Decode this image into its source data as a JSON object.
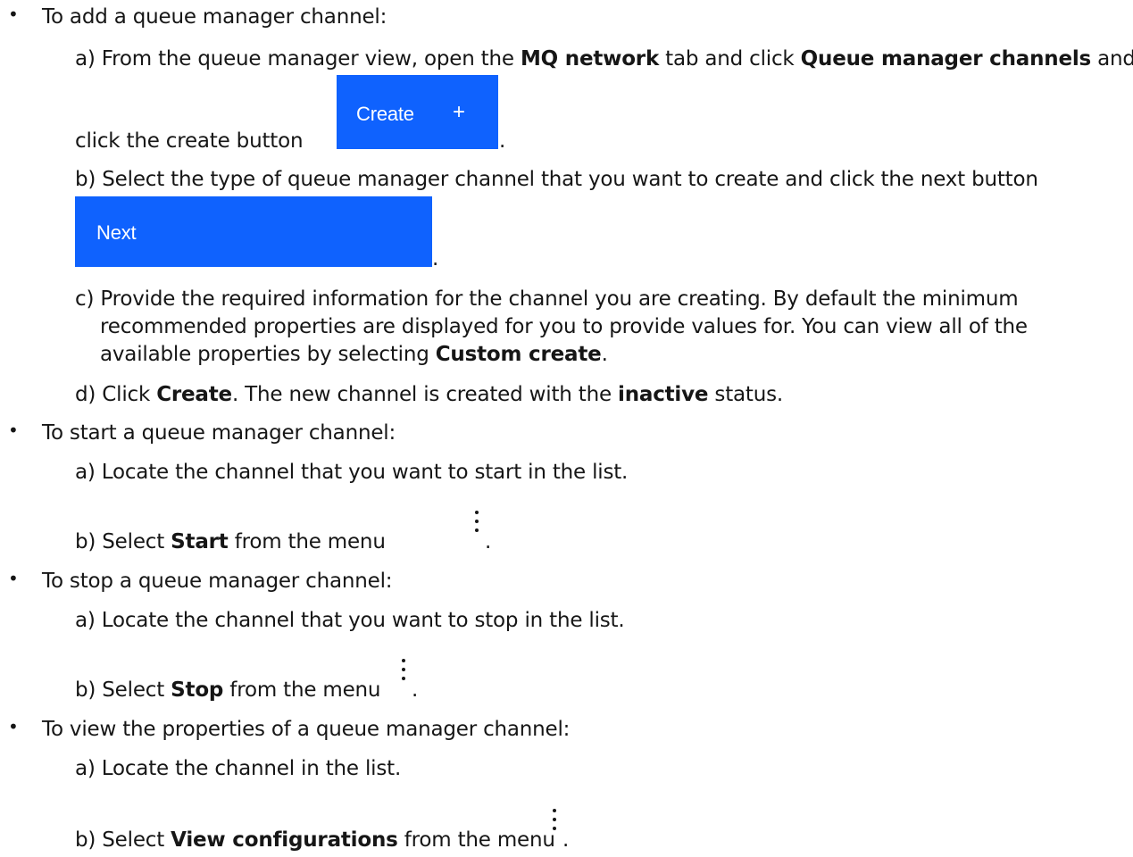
{
  "sections": [
    {
      "intro": "To add a queue manager channel:",
      "steps": {
        "a_prefix": "a) From the queue manager view, open the ",
        "a_b1": "MQ network",
        "a_mid": " tab and click ",
        "a_b2": "Queue manager channels",
        "a_end": " and",
        "a_cont": "click the create button",
        "a_dot": ".",
        "create_button_label": "Create",
        "create_button_icon": "+",
        "b_text": "b) Select the type of queue manager channel that you want to create and click the next button",
        "next_button_label": "Next",
        "b_dot": ".",
        "c_line1": "c) Provide the required information for the channel you are creating. By default the minimum",
        "c_line2": "recommended properties are displayed for you to provide values for. You can view all of the",
        "c_line3_prefix": "available properties by selecting ",
        "c_line3_bold": "Custom create",
        "c_line3_end": ".",
        "d_prefix": "d) Click ",
        "d_b1": "Create",
        "d_mid": ". The new channel is created with the ",
        "d_b2": "inactive",
        "d_end": " status."
      }
    },
    {
      "intro": "To start a queue manager channel:",
      "step_a": "a) Locate the channel that you want to start in the list.",
      "step_b_prefix": "b) Select ",
      "step_b_bold": "Start",
      "step_b_end": " from the menu",
      "dot": "."
    },
    {
      "intro": "To stop a queue manager channel:",
      "step_a": "a) Locate the channel that you want to stop in the list.",
      "step_b_prefix": "b) Select ",
      "step_b_bold": "Stop",
      "step_b_end": " from the menu",
      "dot": "."
    },
    {
      "intro": "To view the properties of a queue manager channel:",
      "step_a": "a) Locate the channel in the list.",
      "step_b_prefix": "b) Select ",
      "step_b_bold": "View configurations",
      "step_b_end": " from the menu",
      "dot": "."
    }
  ],
  "bullet": "•",
  "colors": {
    "button_blue": "#0f62fe",
    "text": "#161616"
  },
  "icons": {
    "menu": "overflow-menu-vertical-icon"
  }
}
